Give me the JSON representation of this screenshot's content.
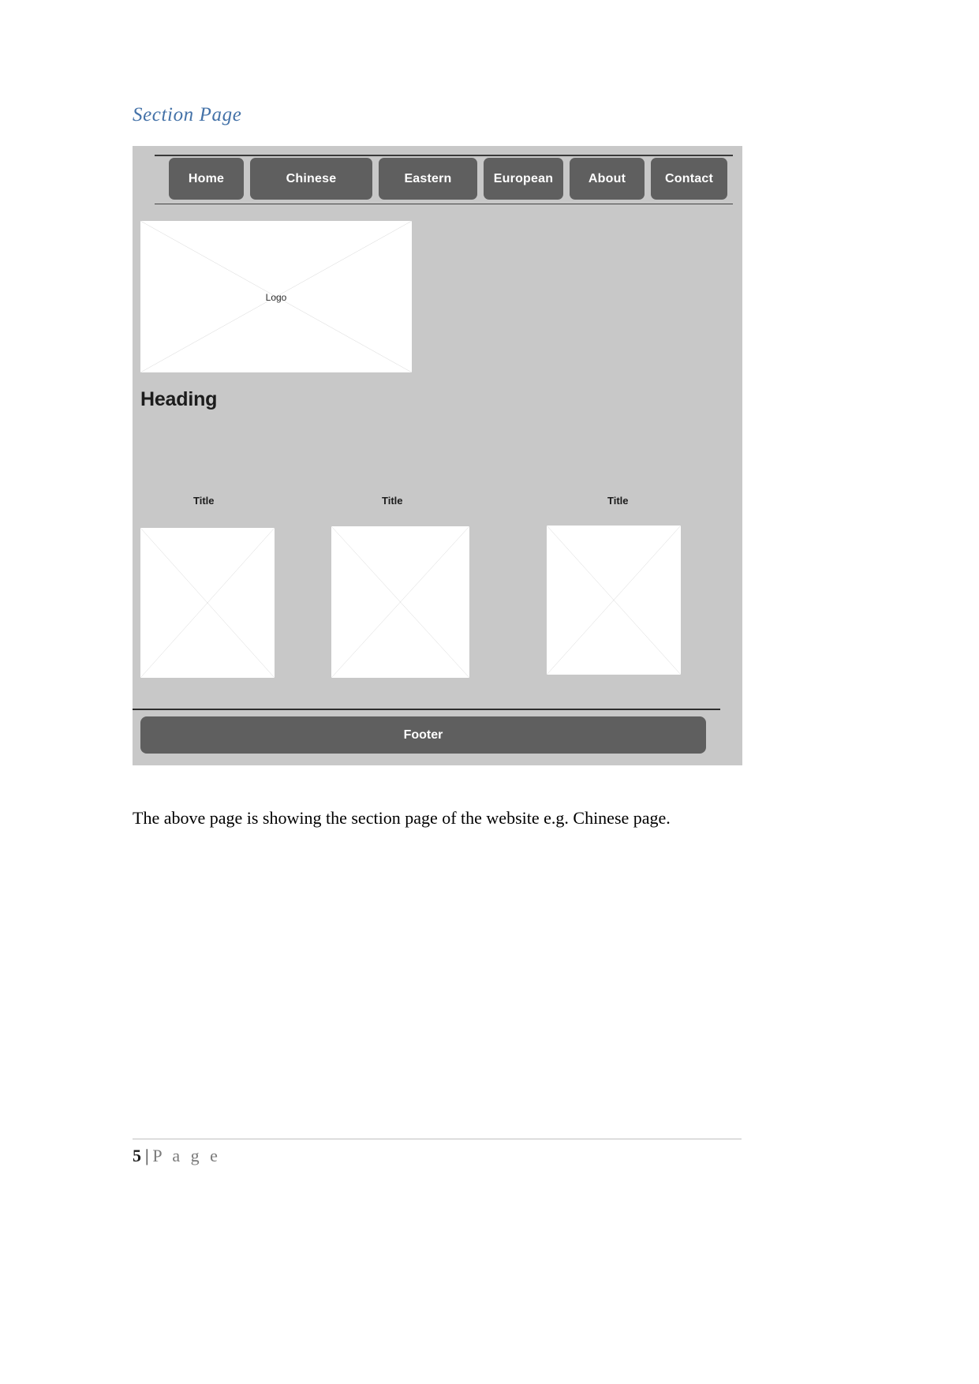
{
  "document": {
    "section_heading": "Section Page",
    "caption": "The above page is showing the section page of the website e.g. Chinese page.",
    "page_number": "5",
    "page_separator": "|",
    "page_word": "P a g e"
  },
  "colors": {
    "heading_blue": "#4472A8",
    "wireframe_bg": "#C8C8C8",
    "button_gray": "#5F5F5F",
    "placeholder_white": "#FFFFFF",
    "rule_dark": "#3A3A3A"
  },
  "wireframe": {
    "nav": {
      "items": [
        {
          "label": "Home"
        },
        {
          "label": "Chinese"
        },
        {
          "label": "Eastern"
        },
        {
          "label": "European"
        },
        {
          "label": "About"
        },
        {
          "label": "Contact"
        }
      ]
    },
    "logo": {
      "label": "Logo"
    },
    "heading": "Heading",
    "cards": [
      {
        "title": "Title"
      },
      {
        "title": "Title"
      },
      {
        "title": "Title"
      }
    ],
    "footer": {
      "label": "Footer"
    }
  }
}
